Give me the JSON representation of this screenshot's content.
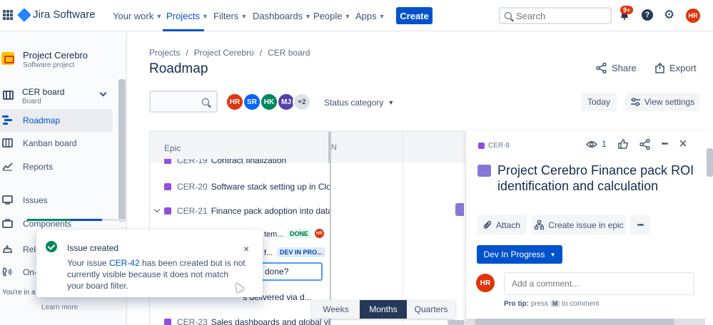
{
  "topnav": {
    "brand": "Jira Software",
    "items": [
      {
        "label": "Your work"
      },
      {
        "label": "Projects"
      },
      {
        "label": "Filters"
      },
      {
        "label": "Dashboards"
      },
      {
        "label": "People"
      },
      {
        "label": "Apps"
      }
    ],
    "create_label": "Create",
    "search_placeholder": "Search",
    "notifications_badge": "9+",
    "help_glyph": "?",
    "user_initials": "HR"
  },
  "sidebar": {
    "project_name": "Project Cerebro",
    "project_type": "Software project",
    "board_name": "CER board",
    "board_sub": "Board",
    "items": [
      {
        "label": "Roadmap",
        "icon": "roadmap-icon"
      },
      {
        "label": "Kanban board",
        "icon": "kanban-icon"
      },
      {
        "label": "Reports",
        "icon": "reports-icon"
      },
      {
        "label": "Issues",
        "icon": "issues-icon"
      },
      {
        "label": "Components",
        "icon": "components-icon"
      },
      {
        "label": "Rele",
        "icon": "releases-icon"
      },
      {
        "label": "On-",
        "icon": "oncall-icon"
      }
    ],
    "filter_note": "You're in a",
    "learn_more": "Learn more"
  },
  "main": {
    "breadcrumb": [
      "Projects",
      "/",
      "Project Cerebro",
      "/",
      "CER board"
    ],
    "title": "Roadmap",
    "share_label": "Share",
    "export_label": "Export",
    "avatars": [
      {
        "initials": "HR",
        "color": "#de350b"
      },
      {
        "initials": "SR",
        "color": "#0065ff"
      },
      {
        "initials": "HK",
        "color": "#00875a"
      },
      {
        "initials": "MJ",
        "color": "#5243aa"
      },
      {
        "initials": "+2",
        "color": "#dfe1e6"
      }
    ],
    "status_category_label": "Status category",
    "today_label": "Today",
    "view_settings_label": "View settings"
  },
  "roadmap": {
    "epic_header": "Epic",
    "timeline_header": "N",
    "rows": [
      {
        "key": "CER-19",
        "summary": "Contract finalization"
      },
      {
        "key": "CER-20",
        "summary": "Software stack setting up in Clo..."
      },
      {
        "key": "CER-21",
        "summary": "Finance pack adoption into data..."
      }
    ],
    "children": [
      {
        "summary": "tem...",
        "status": "DONE",
        "assignee": "HR"
      },
      {
        "summary": "f...",
        "status": "DEV IN PRO..."
      }
    ],
    "inline_input_value": "done?",
    "row_partial": "s delivered via d...",
    "last_row": {
      "key": "CER-23",
      "summary": "Sales dashboards and global vie..."
    },
    "zoom": [
      "Weeks",
      "Months",
      "Quarters"
    ],
    "zoom_selected": "Months"
  },
  "toast": {
    "title": "Issue created",
    "body_prefix": "Your issue ",
    "issue_link": "CER-42",
    "body_suffix": " has been created but is not currently visible because it does not match your board filter.",
    "close_glyph": "×"
  },
  "panel": {
    "issue_key": "CER-8",
    "watch_count": "1",
    "title": "Project Cerebro Finance pack ROI identification and calculation",
    "attach_label": "Attach",
    "create_in_epic_label": "Create issue in epic",
    "more_glyph": "•••",
    "close_glyph": "×",
    "status_label": "Dev In Progress",
    "comment_avatar": "HR",
    "comment_placeholder": "Add a comment...",
    "protip_label": "Pro tip:",
    "protip_press": "press",
    "protip_key": "M",
    "protip_suffix": "to comment"
  }
}
